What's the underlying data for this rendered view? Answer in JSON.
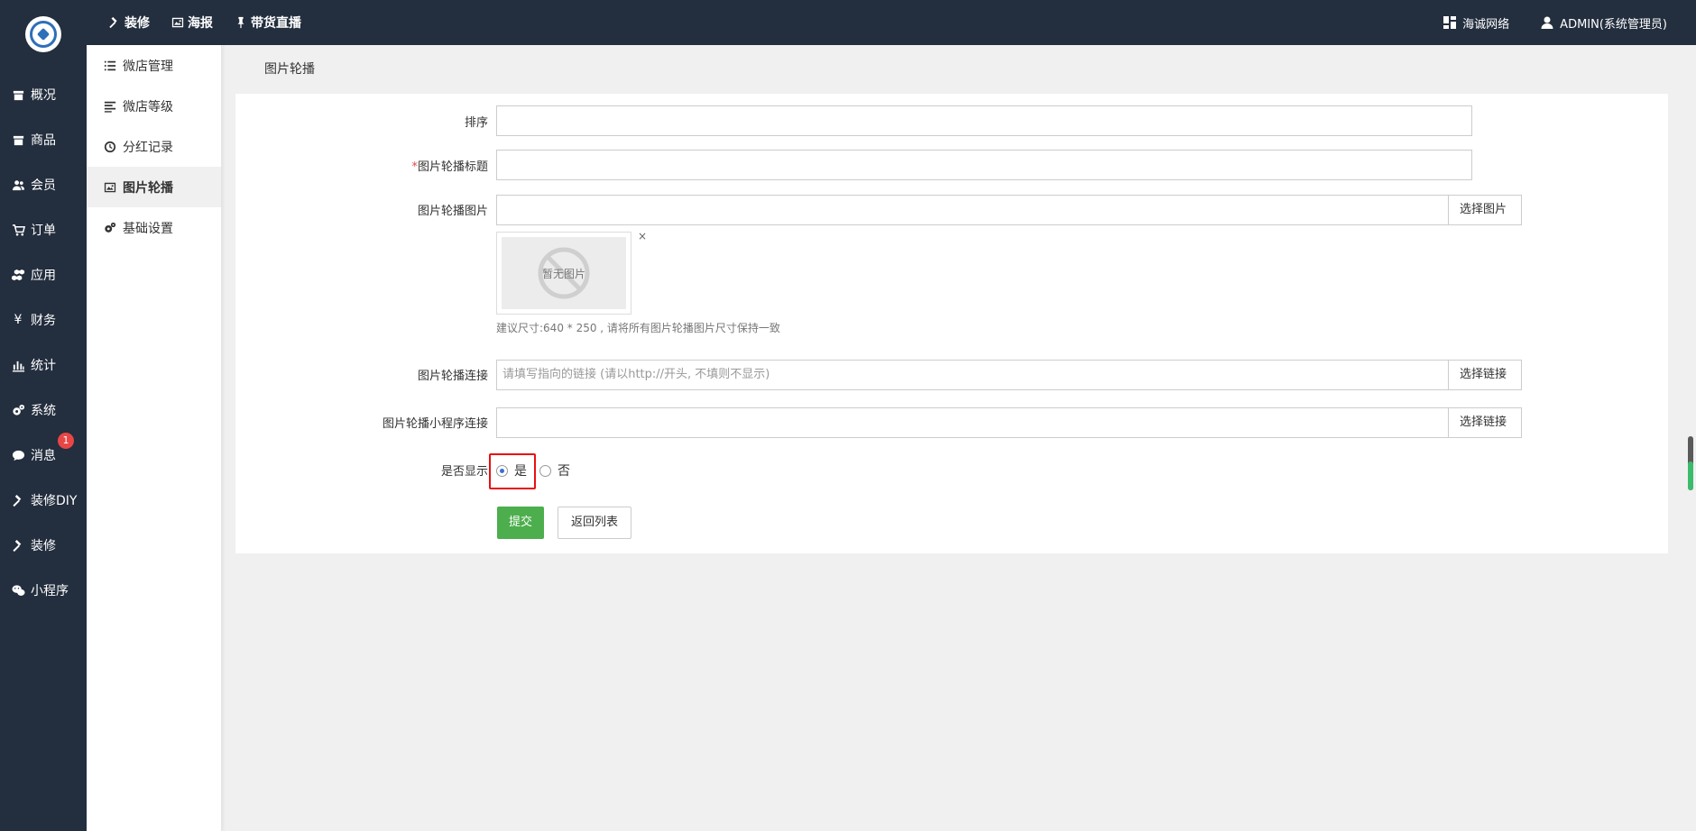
{
  "rail": {
    "items": [
      {
        "label": "概况",
        "icon": "box-icon"
      },
      {
        "label": "商品",
        "icon": "box-icon"
      },
      {
        "label": "会员",
        "icon": "users-icon"
      },
      {
        "label": "订单",
        "icon": "cart-icon"
      },
      {
        "label": "应用",
        "icon": "cubes-icon"
      },
      {
        "label": "财务",
        "icon": "yen-icon"
      },
      {
        "label": "统计",
        "icon": "bar-chart-icon"
      },
      {
        "label": "系统",
        "icon": "gears-icon"
      },
      {
        "label": "消息",
        "icon": "chat-bubble-icon",
        "badge": "1"
      },
      {
        "label": "装修DIY",
        "icon": "gavel-icon"
      },
      {
        "label": "装修",
        "icon": "gavel-icon"
      },
      {
        "label": "小程序",
        "icon": "wechat-icon"
      }
    ]
  },
  "topbar": {
    "nav": [
      {
        "label": "装修",
        "icon": "gavel-icon"
      },
      {
        "label": "海报",
        "icon": "image-icon"
      },
      {
        "label": "带货直播",
        "icon": "pin-icon"
      }
    ],
    "company": "海诚网络",
    "user": "ADMIN(系统管理员)"
  },
  "subside": {
    "items": [
      {
        "label": "微店管理",
        "icon": "list-icon"
      },
      {
        "label": "微店等级",
        "icon": "align-left-icon"
      },
      {
        "label": "分红记录",
        "icon": "clock-icon"
      },
      {
        "label": "图片轮播",
        "icon": "image-icon",
        "active": true
      },
      {
        "label": "基础设置",
        "icon": "gears-icon"
      }
    ]
  },
  "page": {
    "title": "图片轮播"
  },
  "form": {
    "sort_label": "排序",
    "title_label": "图片轮播标题",
    "required_mark": "*",
    "image_label": "图片轮播图片",
    "choose_image": "选择图片",
    "no_image": "暂无图片",
    "close": "×",
    "hint": "建议尺寸:640 * 250 , 请将所有图片轮播图片尺寸保持一致",
    "link_label": "图片轮播连接",
    "link_placeholder": "请填写指向的链接 (请以http://开头, 不填则不显示)",
    "choose_link": "选择链接",
    "mini_link_label": "图片轮播小程序连接",
    "choose_link_2": "选择链接",
    "show_label": "是否显示",
    "yes": "是",
    "no": "否",
    "show_value": "是",
    "submit": "提交",
    "back": "返回列表"
  },
  "colors": {
    "dark": "#232e3e",
    "submit_green": "#4cae4c",
    "highlight_red": "#e81010",
    "badge_red": "#e84646"
  }
}
